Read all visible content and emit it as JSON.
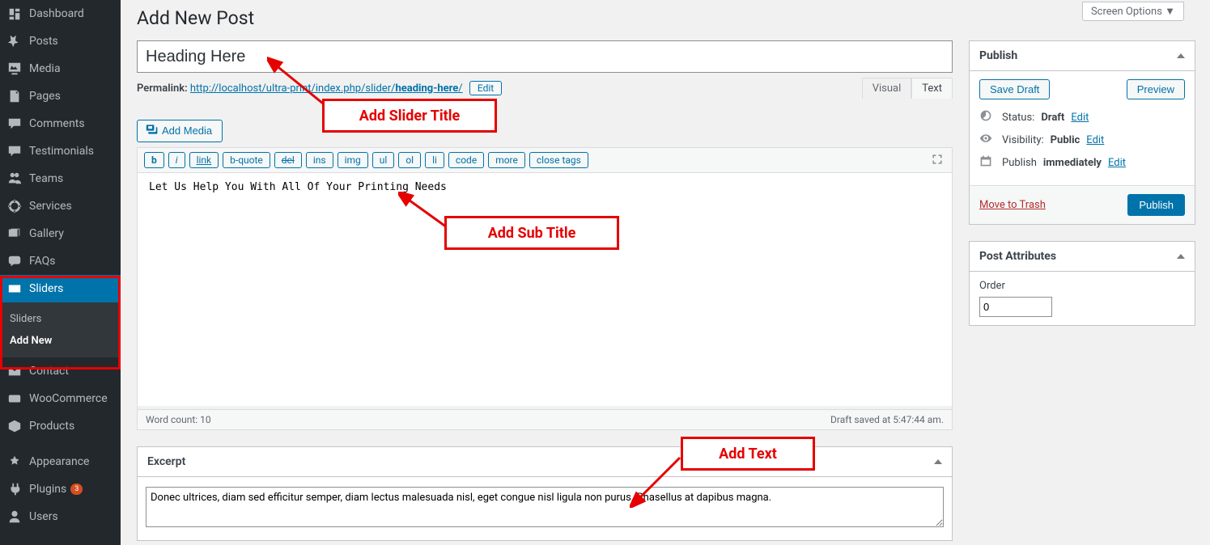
{
  "screen_options": "Screen Options ▼",
  "page_title": "Add New Post",
  "sidebar": {
    "items": [
      {
        "icon": "dashboard",
        "label": "Dashboard"
      },
      {
        "icon": "pin",
        "label": "Posts"
      },
      {
        "icon": "media",
        "label": "Media"
      },
      {
        "icon": "page",
        "label": "Pages"
      },
      {
        "icon": "comment",
        "label": "Comments"
      },
      {
        "icon": "testimonial",
        "label": "Testimonials"
      },
      {
        "icon": "team",
        "label": "Teams"
      },
      {
        "icon": "service",
        "label": "Services"
      },
      {
        "icon": "gallery",
        "label": "Gallery"
      },
      {
        "icon": "faq",
        "label": "FAQs"
      },
      {
        "icon": "slider",
        "label": "Sliders",
        "active": true
      },
      {
        "icon": "contact",
        "label": "Contact"
      },
      {
        "icon": "woo",
        "label": "WooCommerce"
      },
      {
        "icon": "product",
        "label": "Products"
      },
      {
        "icon": "appearance",
        "label": "Appearance"
      },
      {
        "icon": "plugin",
        "label": "Plugins",
        "badge": "3"
      },
      {
        "icon": "user",
        "label": "Users"
      }
    ],
    "submenu": [
      "Sliders",
      "Add New"
    ]
  },
  "title_value": "Heading Here",
  "permalink": {
    "label": "Permalink:",
    "base": "http://localhost/ultra-print/index.php/slider/",
    "slug": "heading-here",
    "edit": "Edit"
  },
  "add_media": "Add Media",
  "tabs": {
    "visual": "Visual",
    "text": "Text"
  },
  "quicktags": [
    "b",
    "i",
    "link",
    "b-quote",
    "del",
    "ins",
    "img",
    "ul",
    "ol",
    "li",
    "code",
    "more",
    "close tags"
  ],
  "editor_content": "Let Us Help You With All Of Your Printing Needs",
  "word_count": "Word count: 10",
  "draft_saved": "Draft saved at 5:47:44 am.",
  "excerpt": {
    "title": "Excerpt",
    "value": "Donec ultrices, diam sed efficitur semper, diam lectus malesuada nisl, eget congue nisl ligula non purus. Phasellus at dapibus magna."
  },
  "publish": {
    "title": "Publish",
    "save_draft": "Save Draft",
    "preview": "Preview",
    "status_label": "Status:",
    "status_value": "Draft",
    "edit": "Edit",
    "vis_label": "Visibility:",
    "vis_value": "Public",
    "sched_label": "Publish",
    "sched_value": "immediately",
    "trash": "Move to Trash",
    "submit": "Publish"
  },
  "attrs": {
    "title": "Post Attributes",
    "order_label": "Order",
    "order_value": "0"
  },
  "annotations": {
    "slider_title": "Add Slider Title",
    "sub_title": "Add Sub Title",
    "add_text": "Add Text"
  }
}
